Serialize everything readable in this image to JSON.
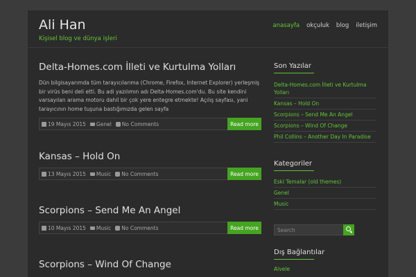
{
  "site": {
    "title": "Ali Han",
    "description": "Kişisel blog ve dünya işleri"
  },
  "nav": [
    {
      "label": "anasayfa",
      "active": true
    },
    {
      "label": "okçuluk",
      "active": false
    },
    {
      "label": "blog",
      "active": false
    },
    {
      "label": "iletişim",
      "active": false
    }
  ],
  "posts": [
    {
      "title": "Delta-Homes.com İlleti ve Kurtulma Yolları",
      "excerpt": "Dün bilgisayarımda tüm tarayıcılarıma (Chrome, Firefox, Internet Explorer) yerleşmiş bir virüs beni deli etti. Bu adi yazılımın adı Delta-Homes.com'du. Bu site kendini varsayılan arama motoru dahil bir çok yere entegre etmekte! Açılış sayfası, yani tarayıcının home tuşuna bastığımızda gelen sayfa",
      "date": "19 Mayıs 2015",
      "category": "Genel",
      "comments": "No Comments",
      "read_more": "Read more"
    },
    {
      "title": "Kansas – Hold On",
      "excerpt": "",
      "date": "13 Mayıs 2015",
      "category": "Music",
      "comments": "No Comments",
      "read_more": "Read more"
    },
    {
      "title": "Scorpions – Send Me An Angel",
      "excerpt": "",
      "date": "10 Mayıs 2015",
      "category": "Music",
      "comments": "No Comments",
      "read_more": "Read more"
    },
    {
      "title": "Scorpions – Wind Of Change",
      "excerpt": "",
      "date": "",
      "category": "",
      "comments": "",
      "read_more": ""
    }
  ],
  "sidebar": {
    "recent_title": "Son Yazılar",
    "recent": [
      "Delta-Homes.com İlleti ve Kurtulma Yolları",
      "Kansas – Hold On",
      "Scorpions – Send Me An Angel",
      "Scorpions – Wind Of Change",
      "Phil Collins – Another Day In Paradise"
    ],
    "categories_title": "Kategoriler",
    "categories": [
      "Eski Temalar (old themes)",
      "Genel",
      "Music"
    ],
    "search_placeholder": "Search",
    "links_title": "Dış Bağlantılar",
    "links": [
      "Alvele"
    ]
  },
  "colors": {
    "accent": "#64c43a",
    "button": "#45a421",
    "background": "#2b2b2b",
    "page": "#3b3b3b"
  }
}
